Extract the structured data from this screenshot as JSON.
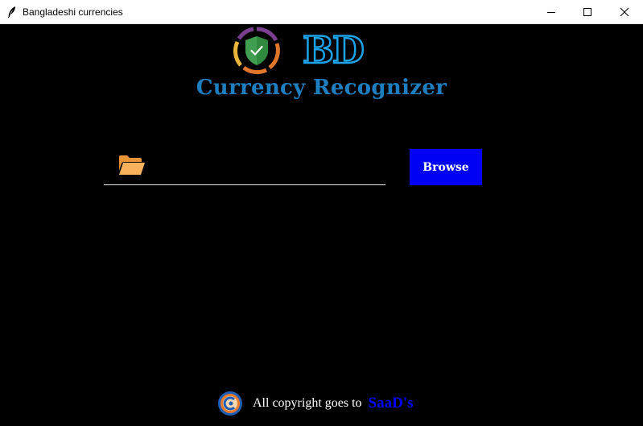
{
  "window": {
    "title": "Bangladeshi currencies",
    "icon": "feather-icon",
    "controls": [
      "minimize-icon",
      "maximize-icon",
      "close-icon"
    ]
  },
  "header": {
    "logo": "shield-check-icon",
    "logo_text": "BD",
    "title": "Currency Recognizer"
  },
  "file_picker": {
    "icon": "folder-open-icon",
    "value": "",
    "placeholder": "",
    "browse_label": "Browse"
  },
  "footer": {
    "logo": "author-logo-icon",
    "text": "All copyright goes to",
    "author": "SaaD's"
  },
  "colors": {
    "background": "#000000",
    "accent_blue": "#1d7fc0",
    "bd_stroke": "#1aa3e8",
    "button_bg": "#0000f5",
    "author": "#0000ff",
    "folder": "#f7a84c"
  }
}
